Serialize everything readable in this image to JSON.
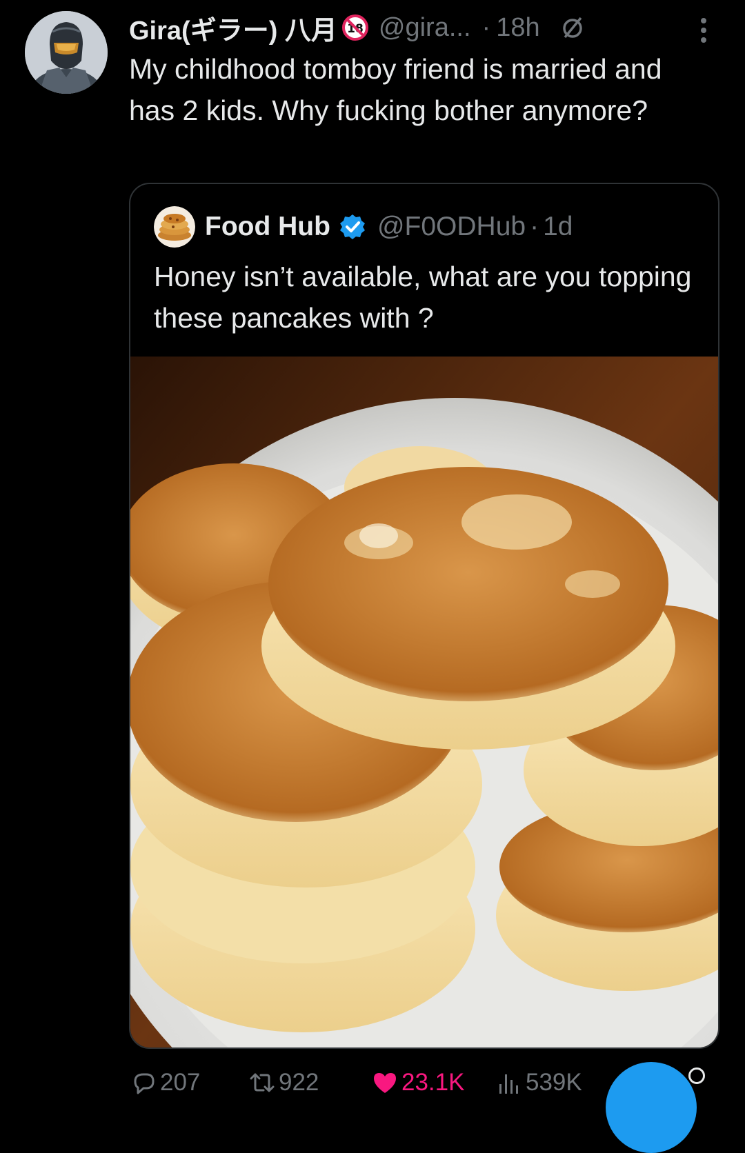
{
  "tweet": {
    "author": {
      "display_name": "Gira(ギラー) 八月",
      "handle": "@gira...",
      "avatar_icon": "armored-helmet-avatar"
    },
    "badge_icon": "no-under-18-icon",
    "separator": "·",
    "time": "18h",
    "status_icon": "empty-set-icon",
    "menu_icon": "more-vertical-icon",
    "text": "My childhood tomboy friend is married and has 2 kids. Why fucking bother anymore?"
  },
  "quote": {
    "author": {
      "display_name": "Food Hub",
      "handle": "@F0ODHub",
      "avatar_icon": "pancake-stack-avatar",
      "verified_icon": "verified-badge-icon"
    },
    "separator": "·",
    "time": "1d",
    "text": "Honey isn’t available, what are you topping these pancakes with ?",
    "image_icon": "pancakes-on-plate-photo"
  },
  "actions": {
    "reply": {
      "icon": "reply-bubble-icon",
      "count": "207"
    },
    "retweet": {
      "icon": "retweet-icon",
      "count": "922"
    },
    "like": {
      "icon": "heart-filled-icon",
      "count": "23.1K",
      "color": "#f91880"
    },
    "views": {
      "icon": "bar-chart-icon",
      "count": "539K"
    }
  },
  "compose_button": {
    "icon": "compose-fab",
    "color": "#1d9bf0"
  },
  "colors": {
    "background": "#000000",
    "text_primary": "#e7e9ea",
    "text_secondary": "#71767b",
    "border": "#2f3336",
    "accent": "#1d9bf0",
    "like": "#f91880"
  }
}
